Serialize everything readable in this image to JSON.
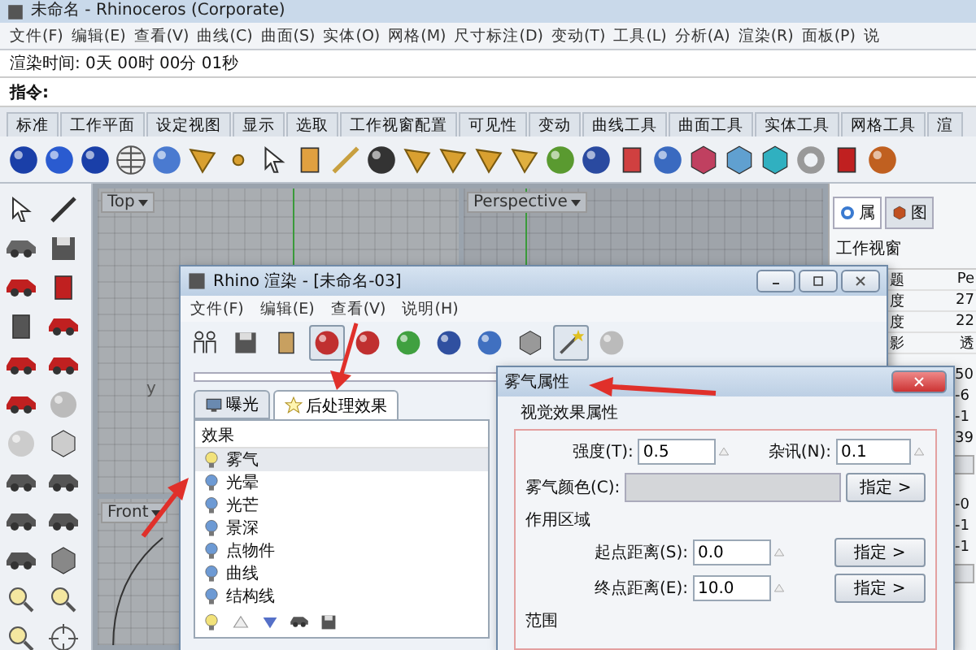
{
  "window": {
    "title": "未命名 - Rhinoceros (Corporate)"
  },
  "menu": [
    "文件(F)",
    "编辑(E)",
    "查看(V)",
    "曲线(C)",
    "曲面(S)",
    "实体(O)",
    "网格(M)",
    "尺寸标注(D)",
    "变动(T)",
    "工具(L)",
    "分析(A)",
    "渲染(R)",
    "面板(P)",
    "说"
  ],
  "command_history": "渲染时间: 0天 00时 00分 01秒",
  "command_prompt": "指令:",
  "toolbar_tabs": [
    "标准",
    "工作平面",
    "设定视图",
    "显示",
    "选取",
    "工作视窗配置",
    "可见性",
    "变动",
    "曲线工具",
    "曲面工具",
    "实体工具",
    "网格工具",
    "渲"
  ],
  "viewports": [
    {
      "label": "Top",
      "axis_label": "y"
    },
    {
      "label": "Perspective"
    },
    {
      "label": "Front"
    }
  ],
  "side_panel": {
    "tabs": [
      {
        "label": "属",
        "selected": true
      },
      {
        "label": "图",
        "selected": false
      }
    ],
    "heading": "工作视窗",
    "properties": [
      {
        "label": "题",
        "value": "Pe"
      },
      {
        "label": "度",
        "value": "27"
      },
      {
        "label": "度",
        "value": "22"
      },
      {
        "label": "影",
        "value": "透"
      }
    ],
    "values_a": [
      "50",
      "-6",
      "-1",
      "39"
    ],
    "values_b": [
      "-0",
      "-1",
      "-1"
    ]
  },
  "render_dialog": {
    "title": "Rhino 渲染 - [未命名-03]",
    "menu": [
      "文件(F)",
      "编辑(E)",
      "查看(V)",
      "说明(H)"
    ],
    "tabs": [
      {
        "label": "曝光",
        "selected": false
      },
      {
        "label": "后处理效果",
        "selected": true
      }
    ],
    "list_header": "效果",
    "effects": [
      {
        "label": "雾气",
        "on": true,
        "selected": true
      },
      {
        "label": "光晕",
        "on": false,
        "selected": false
      },
      {
        "label": "光芒",
        "on": false,
        "selected": false
      },
      {
        "label": "景深",
        "on": false,
        "selected": false
      },
      {
        "label": "点物件",
        "on": false,
        "selected": false
      },
      {
        "label": "曲线",
        "on": false,
        "selected": false
      },
      {
        "label": "结构线",
        "on": false,
        "selected": false
      }
    ]
  },
  "fog_dialog": {
    "title": "雾气属性",
    "group_title": "视觉效果属性",
    "strength": {
      "label": "强度(T):",
      "value": "0.5"
    },
    "noise": {
      "label": "杂讯(N):",
      "value": "0.1"
    },
    "color": {
      "label": "雾气颜色(C):",
      "button": "指定 >"
    },
    "area_title": "作用区域",
    "start": {
      "label": "起点距离(S):",
      "value": "0.0",
      "button": "指定 >"
    },
    "end": {
      "label": "终点距离(E):",
      "value": "10.0",
      "button": "指定 >"
    },
    "range_title": "范围"
  }
}
